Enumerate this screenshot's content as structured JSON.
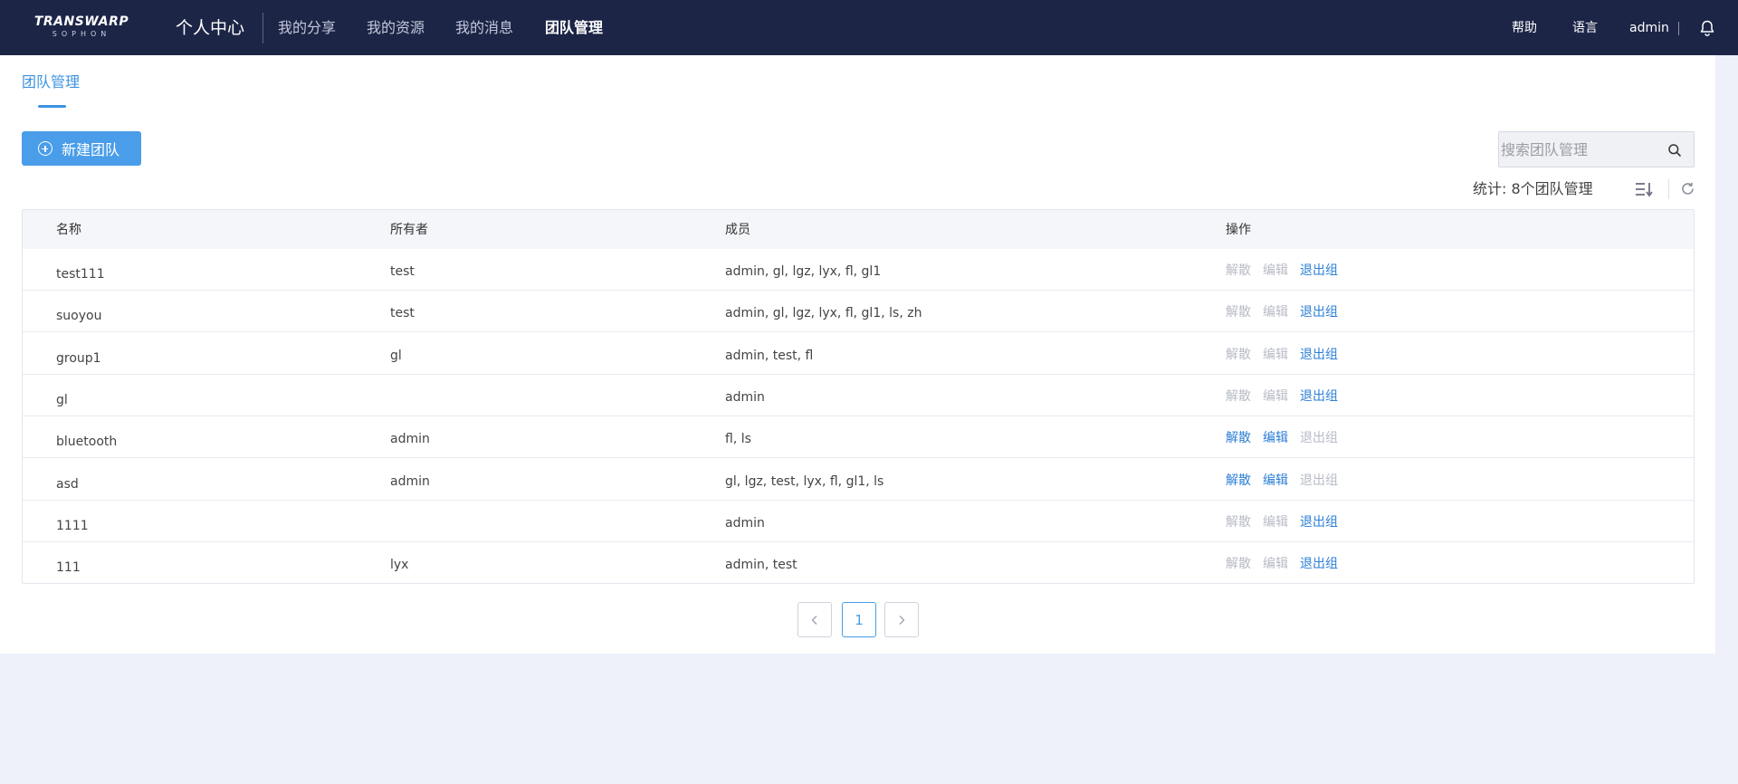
{
  "nav": {
    "logo_brand": "TRANSWARP",
    "logo_sub": "SOPHON",
    "home": "个人中心",
    "links": [
      "我的分享",
      "我的资源",
      "我的消息",
      "团队管理"
    ],
    "active_link": "团队管理",
    "help": "帮助",
    "language": "语言",
    "user": "admin",
    "bell_icon": "bell-icon"
  },
  "page": {
    "tab": "团队管理",
    "new_button": "新建团队",
    "search_placeholder": "搜索团队管理",
    "stats": "统计: 8个团队管理"
  },
  "table": {
    "columns": [
      "名称",
      "所有者",
      "成员",
      "操作"
    ],
    "rows": [
      {
        "name": "test111",
        "owner": "test",
        "members": "admin, gl, lgz, lyx, fl, gl1",
        "ops": [
          {
            "label": "解散",
            "enabled": false
          },
          {
            "label": "编辑",
            "enabled": false
          },
          {
            "label": "退出组",
            "enabled": true
          }
        ]
      },
      {
        "name": "suoyou",
        "owner": "test",
        "members": "admin, gl, lgz, lyx, fl, gl1, ls, zh",
        "ops": [
          {
            "label": "解散",
            "enabled": false
          },
          {
            "label": "编辑",
            "enabled": false
          },
          {
            "label": "退出组",
            "enabled": true
          }
        ]
      },
      {
        "name": "group1",
        "owner": "gl",
        "members": "admin, test, fl",
        "ops": [
          {
            "label": "解散",
            "enabled": false
          },
          {
            "label": "编辑",
            "enabled": false
          },
          {
            "label": "退出组",
            "enabled": true
          }
        ]
      },
      {
        "name": "gl",
        "owner": "",
        "members": "admin",
        "ops": [
          {
            "label": "解散",
            "enabled": false
          },
          {
            "label": "编辑",
            "enabled": false
          },
          {
            "label": "退出组",
            "enabled": true
          }
        ]
      },
      {
        "name": "bluetooth",
        "owner": "admin",
        "members": "fl, ls",
        "ops": [
          {
            "label": "解散",
            "enabled": true
          },
          {
            "label": "编辑",
            "enabled": true
          },
          {
            "label": "退出组",
            "enabled": false
          }
        ]
      },
      {
        "name": "asd",
        "owner": "admin",
        "members": "gl, lgz, test, lyx, fl, gl1, ls",
        "ops": [
          {
            "label": "解散",
            "enabled": true
          },
          {
            "label": "编辑",
            "enabled": true
          },
          {
            "label": "退出组",
            "enabled": false
          }
        ]
      },
      {
        "name": "1111",
        "owner": "",
        "members": "admin",
        "ops": [
          {
            "label": "解散",
            "enabled": false
          },
          {
            "label": "编辑",
            "enabled": false
          },
          {
            "label": "退出组",
            "enabled": true
          }
        ]
      },
      {
        "name": "111",
        "owner": "lyx",
        "members": "admin, test",
        "ops": [
          {
            "label": "解散",
            "enabled": false
          },
          {
            "label": "编辑",
            "enabled": false
          },
          {
            "label": "退出组",
            "enabled": true
          }
        ]
      }
    ]
  },
  "pagination": {
    "current_page": "1"
  },
  "colors": {
    "topbar": "#1d2547",
    "accent": "#4a9de8",
    "link": "#2c7fd6",
    "disabled": "#b7bbc6"
  }
}
